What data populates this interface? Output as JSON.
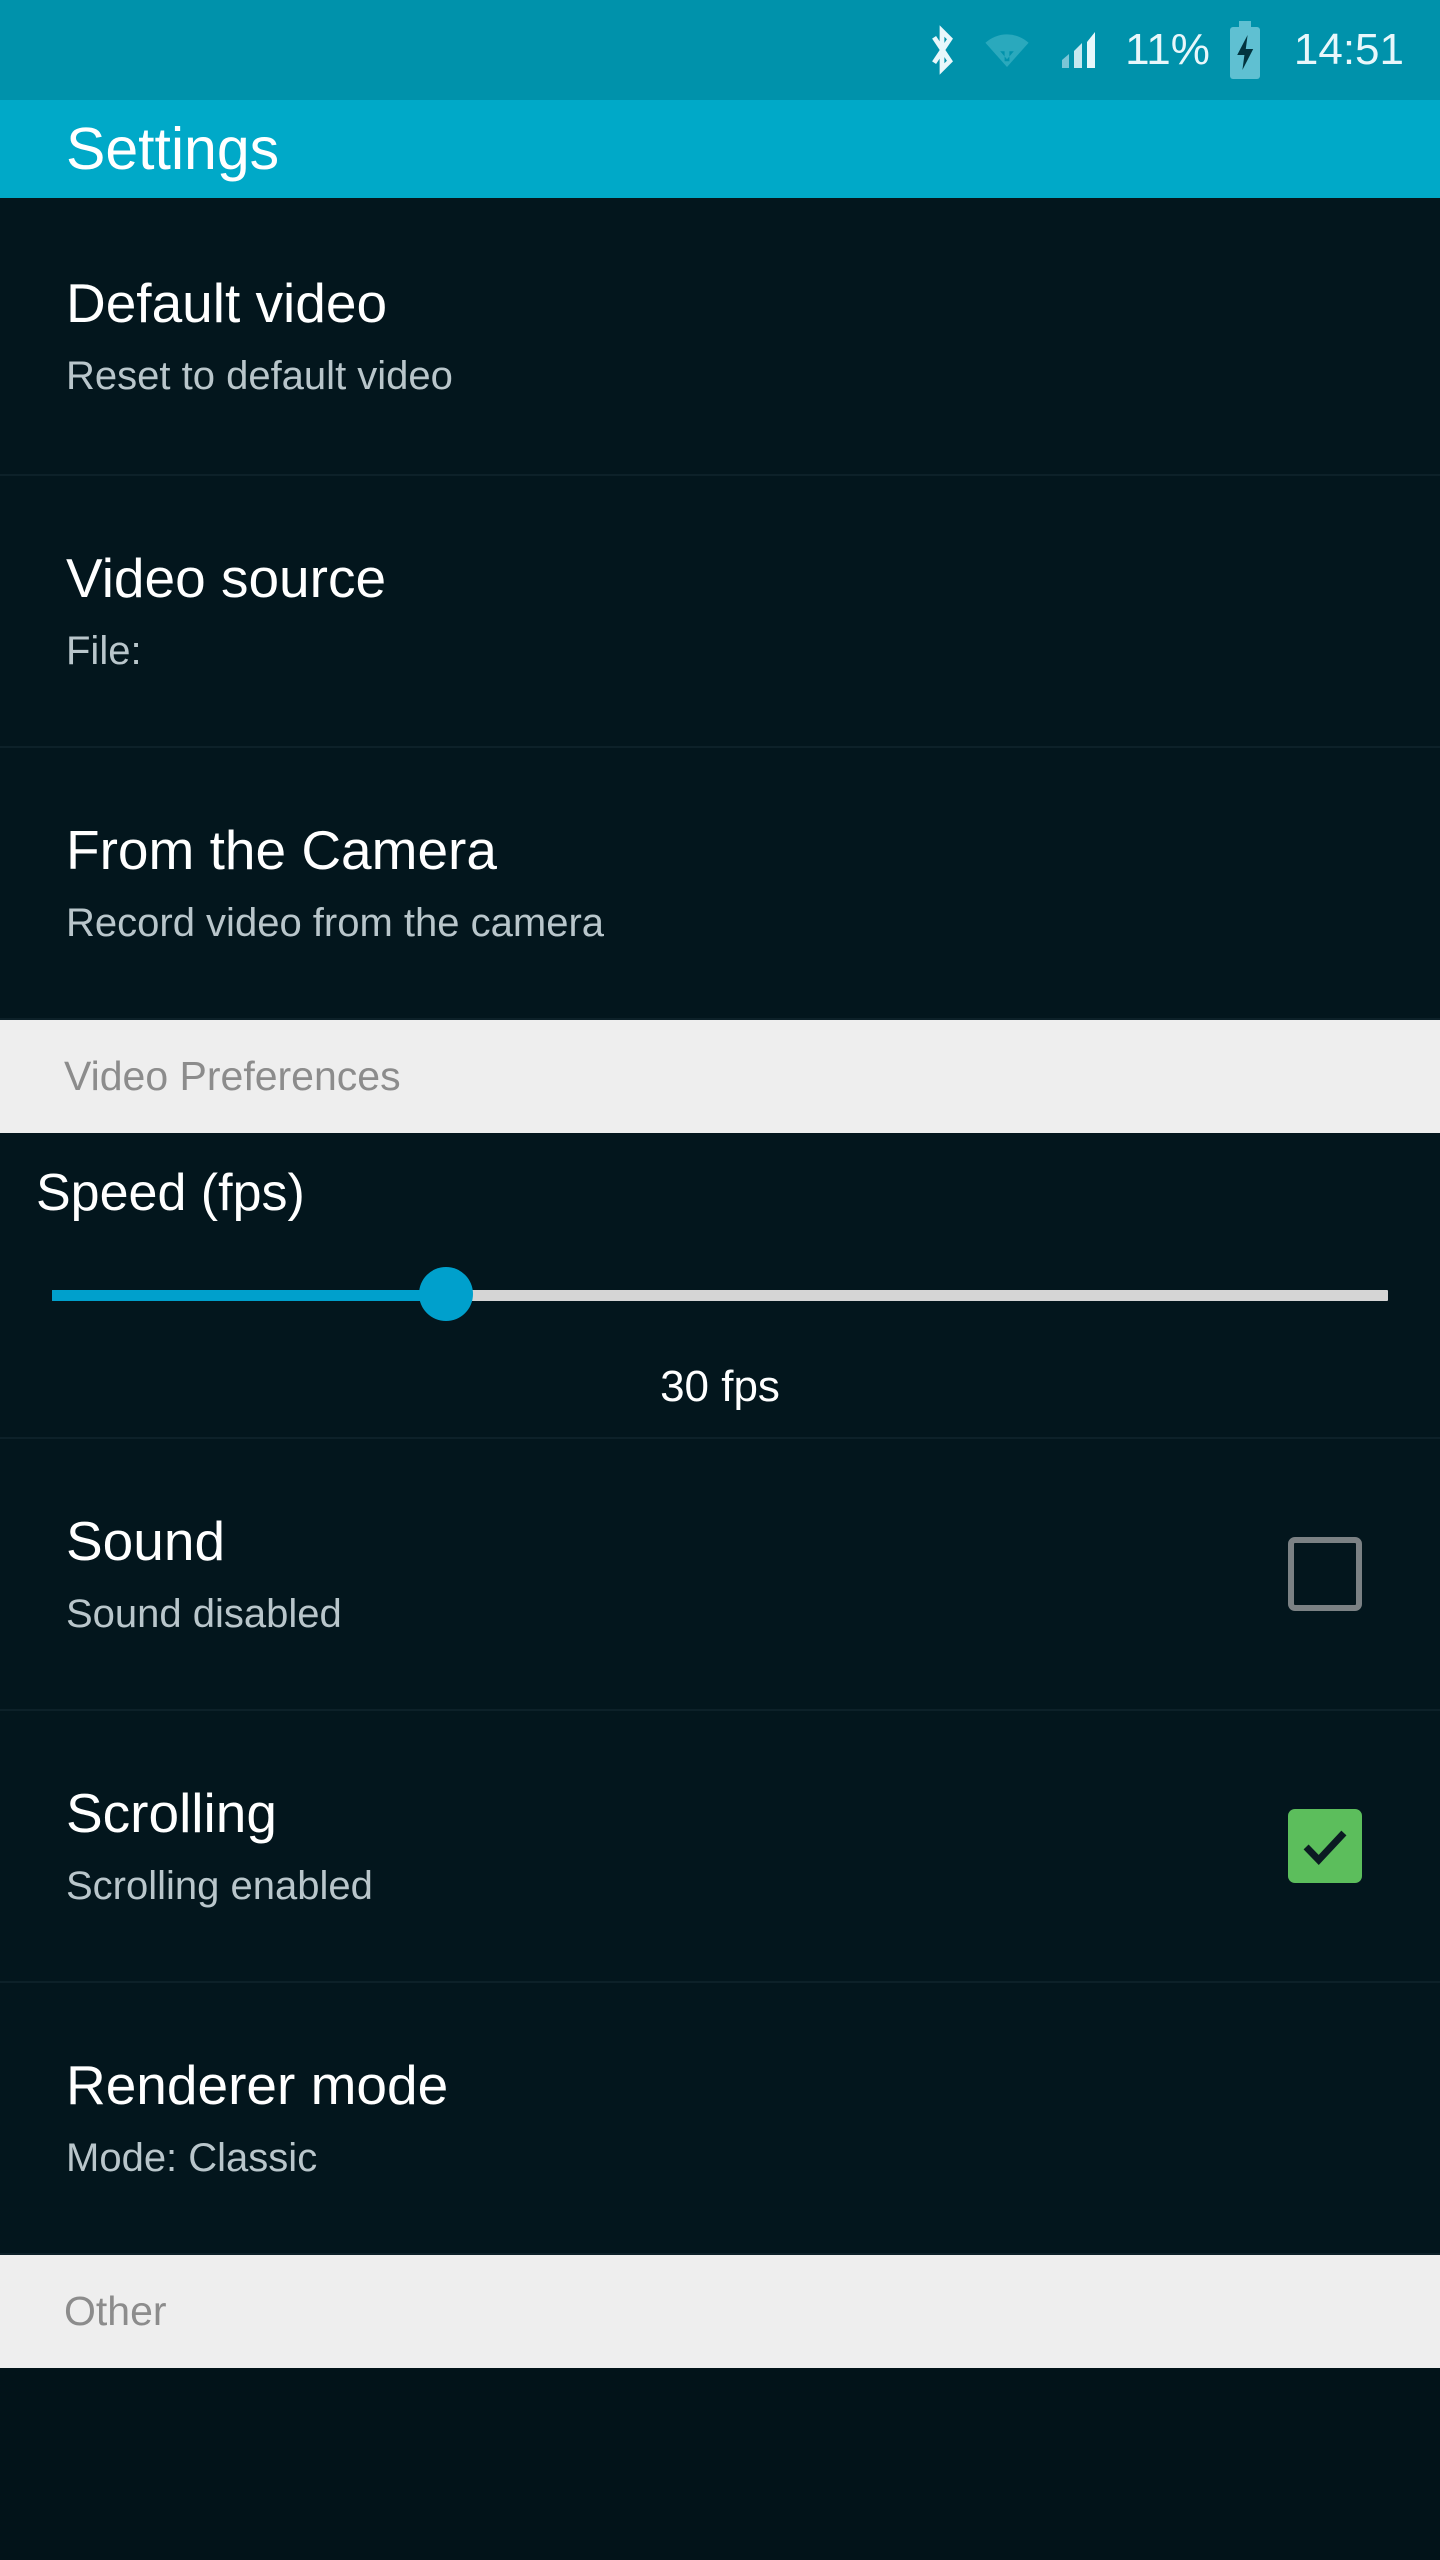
{
  "status_bar": {
    "background": "#0092ab",
    "icons": [
      "bluetooth-icon",
      "wifi-icon",
      "cellular-signal-icon",
      "battery-charging-icon"
    ],
    "battery_percent": "11%",
    "clock": "14:51"
  },
  "app_bar": {
    "background": "#00a9c8",
    "title": "Settings"
  },
  "preferences": [
    {
      "title": "Default video",
      "summary": "Reset to default video"
    },
    {
      "title": "Video source",
      "summary": "File:"
    },
    {
      "title": "From the Camera",
      "summary": "Record video from the camera"
    }
  ],
  "video_preferences": {
    "header": "Video Preferences",
    "speed": {
      "title": "Speed (fps)",
      "value_label": "30 fps",
      "percent": 29.5,
      "track_color": "#d5d5d5",
      "progress_color": "#00a0cc"
    },
    "sound": {
      "title": "Sound",
      "summary": "Sound disabled",
      "checked": false
    },
    "scrolling": {
      "title": "Scrolling",
      "summary": "Scrolling enabled",
      "checked": true,
      "checked_color": "#5cbe5c"
    },
    "renderer": {
      "title": "Renderer mode",
      "summary": "Mode: Classic"
    }
  },
  "other_section": {
    "header": "Other"
  }
}
